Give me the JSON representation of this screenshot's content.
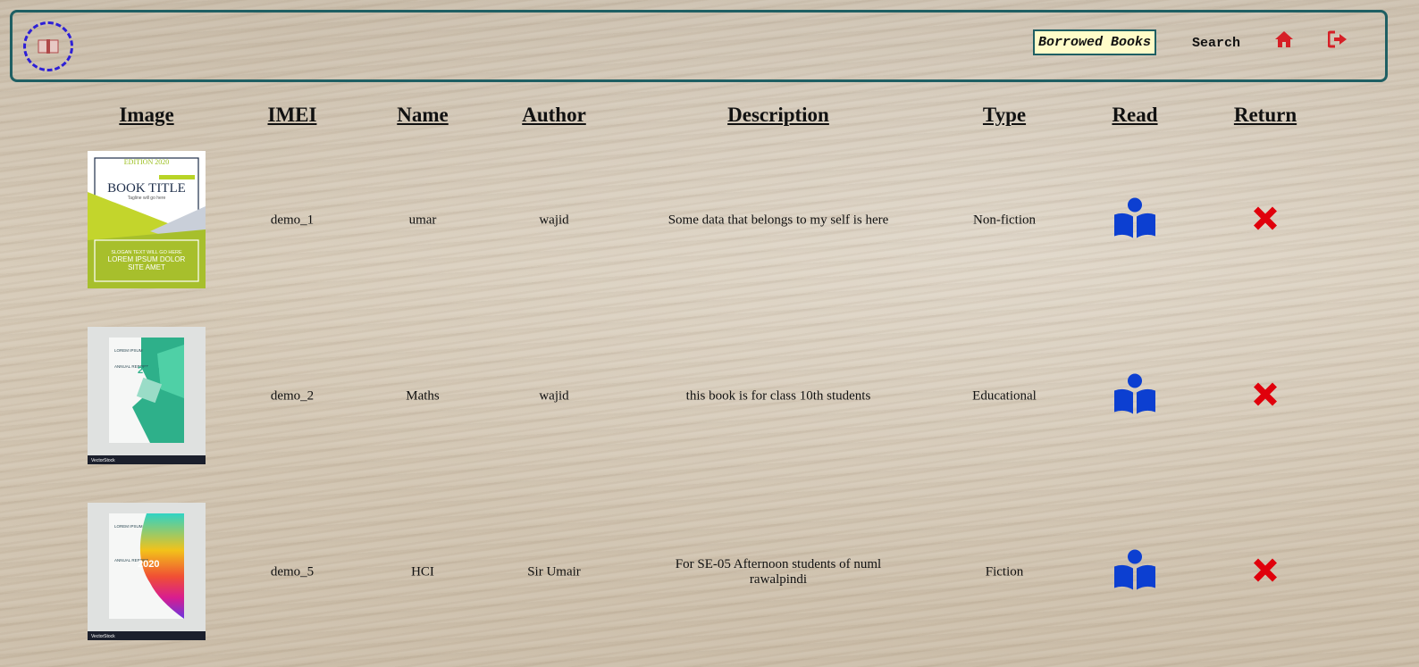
{
  "nav": {
    "active_label": "Borrowed Books",
    "search_label": "Search",
    "home_icon": "home-icon",
    "logout_icon": "sign-out-icon",
    "icon_color": "#d61f26"
  },
  "table": {
    "headers": [
      "Image",
      "IMEI",
      "Name",
      "Author",
      "Description",
      "Type",
      "Read",
      "Return"
    ],
    "rows": [
      {
        "imei": "demo_1",
        "name": "umar",
        "author": "wajid",
        "description": "Some data that belongs to my self is here",
        "type": "Non-fiction"
      },
      {
        "imei": "demo_2",
        "name": "Maths",
        "author": "wajid",
        "description": "this book is for class 10th students",
        "type": "Educational"
      },
      {
        "imei": "demo_5",
        "name": "HCI",
        "author": "Sir Umair",
        "description": "For SE-05 Afternoon students of numl rawalpindi",
        "type": "Fiction"
      }
    ]
  },
  "covers": [
    {
      "edition": "EDITION 2020",
      "title": "BOOK TITLE",
      "tagline": "Tagline will go here",
      "slogan": "SLOGAN TEXT WILL GO HERE",
      "body": "LOREM IPSUM DOLOR SITE AMET"
    },
    {
      "brand": "VectorStock",
      "year": "2020",
      "heading": "ANNUAL REPORT",
      "name": "LOREM IPSUM"
    },
    {
      "brand": "VectorStock",
      "year": "2020",
      "heading": "ANNUAL REPORT",
      "name": "LOREM IPSUM"
    }
  ],
  "colors": {
    "read_icon": "#0c3fd1",
    "return_icon": "#e0000b",
    "nav_border": "#1f5f63"
  }
}
